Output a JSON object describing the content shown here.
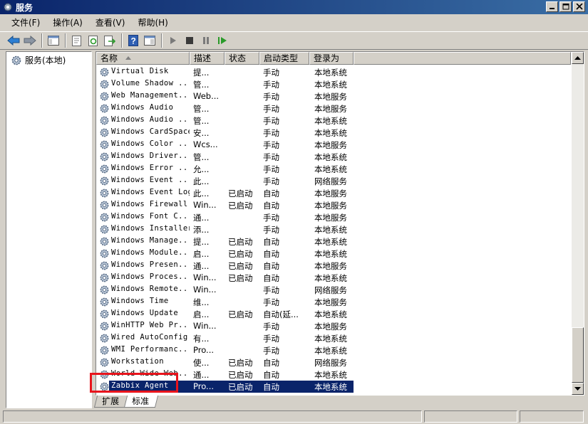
{
  "window": {
    "title": "服务"
  },
  "menu": [
    "文件(F)",
    "操作(A)",
    "查看(V)",
    "帮助(H)"
  ],
  "tree": {
    "root": "服务(本地)"
  },
  "columns": {
    "name": "名称",
    "desc": "描述",
    "state": "状态",
    "startup": "启动类型",
    "logon": "登录为"
  },
  "services": [
    {
      "name": "Virtual Disk",
      "desc": "提...",
      "state": "",
      "startup": "手动",
      "logon": "本地系统"
    },
    {
      "name": "Volume Shadow ...",
      "desc": "管...",
      "state": "",
      "startup": "手动",
      "logon": "本地系统"
    },
    {
      "name": "Web Management...",
      "desc": "Web...",
      "state": "",
      "startup": "手动",
      "logon": "本地服务"
    },
    {
      "name": "Windows Audio",
      "desc": "管...",
      "state": "",
      "startup": "手动",
      "logon": "本地服务"
    },
    {
      "name": "Windows Audio ...",
      "desc": "管...",
      "state": "",
      "startup": "手动",
      "logon": "本地系统"
    },
    {
      "name": "Windows CardSpace",
      "desc": "安...",
      "state": "",
      "startup": "手动",
      "logon": "本地系统"
    },
    {
      "name": "Windows Color ...",
      "desc": "Wcs...",
      "state": "",
      "startup": "手动",
      "logon": "本地服务"
    },
    {
      "name": "Windows Driver...",
      "desc": "管...",
      "state": "",
      "startup": "手动",
      "logon": "本地系统"
    },
    {
      "name": "Windows Error ...",
      "desc": "允...",
      "state": "",
      "startup": "手动",
      "logon": "本地系统"
    },
    {
      "name": "Windows Event ...",
      "desc": "此...",
      "state": "",
      "startup": "手动",
      "logon": "网络服务"
    },
    {
      "name": "Windows Event Log",
      "desc": "此...",
      "state": "已启动",
      "startup": "自动",
      "logon": "本地服务"
    },
    {
      "name": "Windows Firewall",
      "desc": "Win...",
      "state": "已启动",
      "startup": "自动",
      "logon": "本地服务"
    },
    {
      "name": "Windows Font C...",
      "desc": "通...",
      "state": "",
      "startup": "手动",
      "logon": "本地服务"
    },
    {
      "name": "Windows Installer",
      "desc": "添...",
      "state": "",
      "startup": "手动",
      "logon": "本地系统"
    },
    {
      "name": "Windows Manage...",
      "desc": "提...",
      "state": "已启动",
      "startup": "自动",
      "logon": "本地系统"
    },
    {
      "name": "Windows Module...",
      "desc": "启...",
      "state": "已启动",
      "startup": "自动",
      "logon": "本地系统"
    },
    {
      "name": "Windows Presen...",
      "desc": "通...",
      "state": "已启动",
      "startup": "自动",
      "logon": "本地服务"
    },
    {
      "name": "Windows Proces...",
      "desc": "Win...",
      "state": "已启动",
      "startup": "自动",
      "logon": "本地系统"
    },
    {
      "name": "Windows Remote...",
      "desc": "Win...",
      "state": "",
      "startup": "手动",
      "logon": "网络服务"
    },
    {
      "name": "Windows Time",
      "desc": "维...",
      "state": "",
      "startup": "手动",
      "logon": "本地服务"
    },
    {
      "name": "Windows Update",
      "desc": "启...",
      "state": "已启动",
      "startup": "自动(延...",
      "logon": "本地系统"
    },
    {
      "name": "WinHTTP Web Pr...",
      "desc": "Win...",
      "state": "",
      "startup": "手动",
      "logon": "本地服务"
    },
    {
      "name": "Wired AutoConfig",
      "desc": "有...",
      "state": "",
      "startup": "手动",
      "logon": "本地系统"
    },
    {
      "name": "WMI Performanc...",
      "desc": "Pro...",
      "state": "",
      "startup": "手动",
      "logon": "本地系统"
    },
    {
      "name": "Workstation",
      "desc": "使...",
      "state": "已启动",
      "startup": "自动",
      "logon": "网络服务"
    },
    {
      "name": "World Wide Web...",
      "desc": "通...",
      "state": "已启动",
      "startup": "自动",
      "logon": "本地系统"
    },
    {
      "name": "Zabbix Agent",
      "desc": "Pro...",
      "state": "已启动",
      "startup": "自动",
      "logon": "本地系统"
    }
  ],
  "selected_index": 26,
  "tabs": [
    "扩展",
    "标准"
  ],
  "active_tab": 1,
  "colors": {
    "selection": "#0a246a",
    "annotation": "#e8141c",
    "titlebar": "#0a246a"
  }
}
